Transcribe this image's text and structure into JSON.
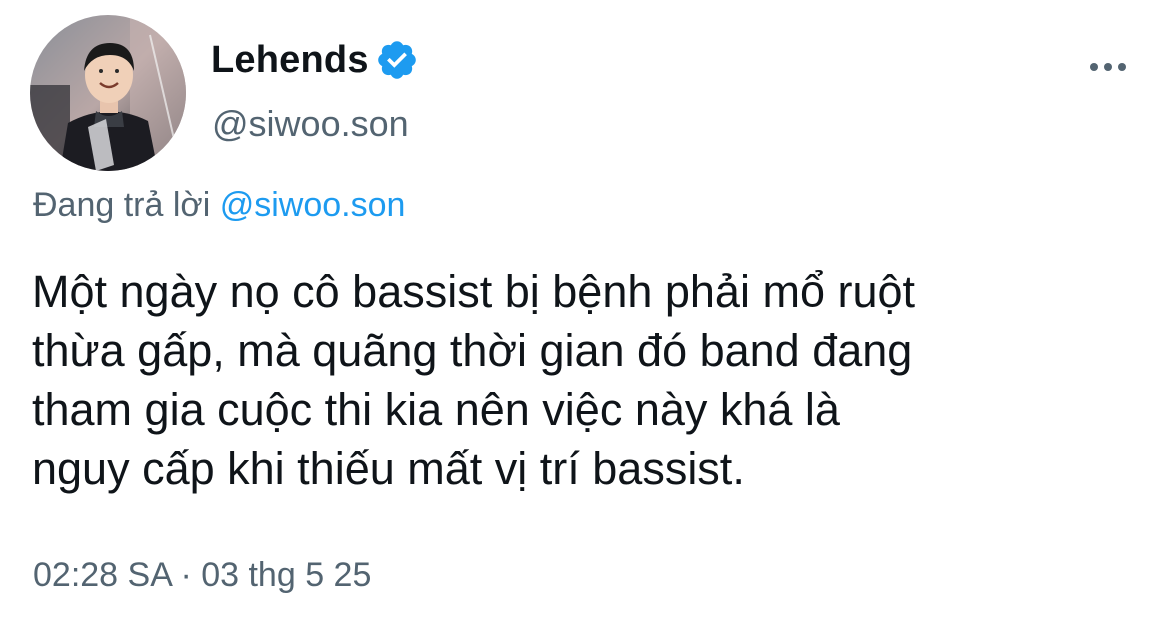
{
  "author": {
    "display_name": "Lehends",
    "handle": "@siwoo.son",
    "verified": true,
    "avatar_icon": "profile-photo"
  },
  "reply": {
    "prefix": "Đang trả lời",
    "mention": "@siwoo.son"
  },
  "tweet": {
    "lines": [
      "Một ngày nọ cô bassist bị bệnh phải mổ ruột",
      "thừa gấp, mà quãng thời gian đó band đang",
      "tham gia cuộc thi kia nên việc này khá là",
      "nguy cấp khi thiếu mất vị trí bassist."
    ]
  },
  "meta": {
    "timestamp": "02:28 SA · 03 thg 5 25"
  },
  "icons": {
    "verified": "verified-badge-icon",
    "more": "more-options-icon"
  },
  "colors": {
    "text": "#0f1419",
    "secondary": "#536471",
    "accent": "#1d9bf0"
  }
}
